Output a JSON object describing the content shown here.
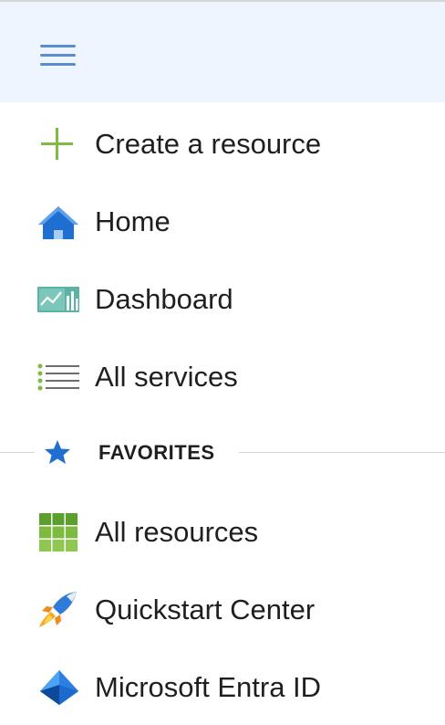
{
  "menu": {
    "items": [
      {
        "label": "Create a resource",
        "icon": "plus-icon"
      },
      {
        "label": "Home",
        "icon": "home-icon"
      },
      {
        "label": "Dashboard",
        "icon": "dashboard-icon"
      },
      {
        "label": "All services",
        "icon": "list-icon"
      }
    ],
    "favorites": {
      "heading": "FAVORITES",
      "icon": "star-icon",
      "items": [
        {
          "label": "All resources",
          "icon": "grid-icon"
        },
        {
          "label": "Quickstart Center",
          "icon": "rocket-icon"
        },
        {
          "label": "Microsoft Entra ID",
          "icon": "entra-id-icon"
        }
      ]
    }
  },
  "colors": {
    "header_background": "#eef5fe",
    "accent_blue": "#0078d4",
    "plus_green": "#7fba42"
  }
}
